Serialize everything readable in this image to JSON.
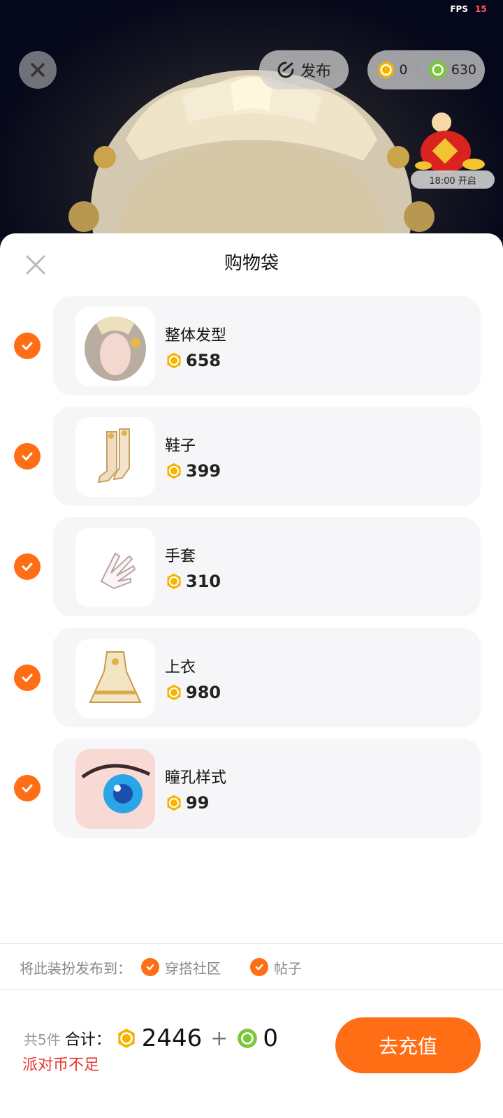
{
  "status": {
    "fps_label": "FPS",
    "fps_value": "15"
  },
  "top_bar": {
    "publish_label": "发布",
    "gold_coins": "0",
    "green_coins": "630",
    "event_time": "18:00 开启"
  },
  "sheet": {
    "title": "购物袋",
    "items": [
      {
        "name": "整体发型",
        "price": "658",
        "checked": true,
        "icon": "hairstyle-thumbnail"
      },
      {
        "name": "鞋子",
        "price": "399",
        "checked": true,
        "icon": "shoes-thumbnail"
      },
      {
        "name": "手套",
        "price": "310",
        "checked": true,
        "icon": "gloves-thumbnail"
      },
      {
        "name": "上衣",
        "price": "980",
        "checked": true,
        "icon": "top-thumbnail"
      },
      {
        "name": "瞳孔样式",
        "price": "99",
        "checked": true,
        "icon": "pupil-thumbnail"
      }
    ],
    "share": {
      "label": "将此装扮发布到：",
      "options": [
        {
          "label": "穿搭社区",
          "checked": true
        },
        {
          "label": "帖子",
          "checked": true
        }
      ]
    },
    "footer": {
      "count": "共5件",
      "sum_label": "合计：",
      "gold_total": "2446",
      "plus": "+",
      "green_total": "0",
      "warning": "派对币不足",
      "recharge_label": "去充值"
    }
  },
  "colors": {
    "accent": "#ff6d14",
    "warning": "#e7362c",
    "coin_gold": "#f4b400",
    "coin_green": "#7bc73a"
  }
}
